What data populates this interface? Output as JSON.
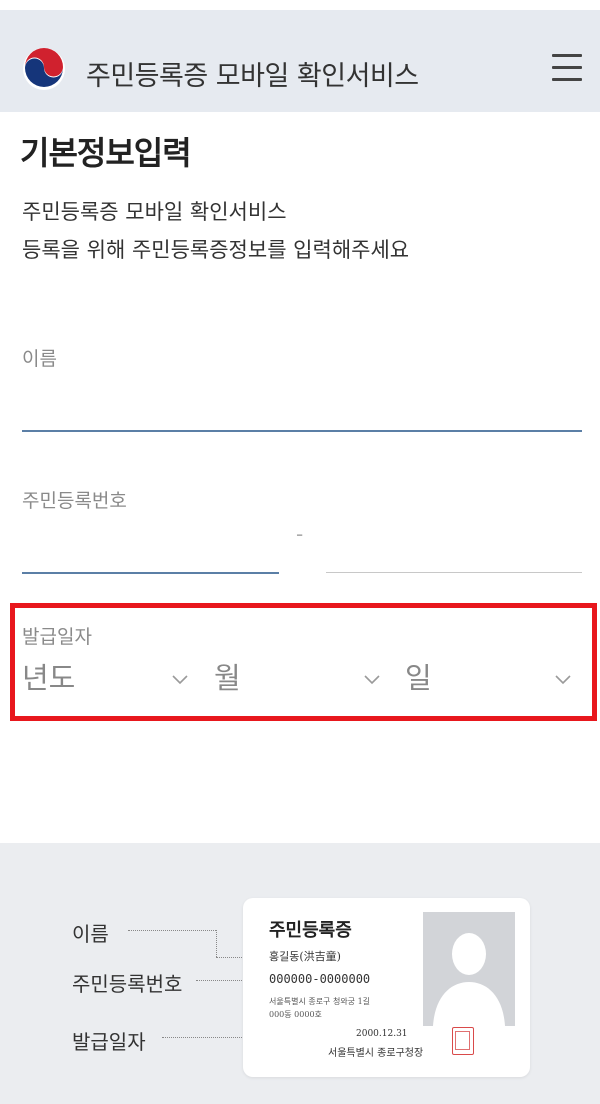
{
  "header": {
    "title": "주민등록증 모바일 확인서비스",
    "logo_icon": "taegeuk-logo-icon",
    "menu_icon": "hamburger-menu-icon"
  },
  "page": {
    "title": "기본정보입력",
    "intro_line1": "주민등록증 모바일 확인서비스",
    "intro_line2": "등록을 위해 주민등록증정보를 입력해주세요"
  },
  "form": {
    "name_label": "이름",
    "name_value": "",
    "rrn_label": "주민등록번호",
    "rrn_front_value": "",
    "rrn_back_value": "",
    "rrn_separator": "-",
    "issue_date_label": "발급일자",
    "year_select": "년도",
    "month_select": "월",
    "day_select": "일"
  },
  "guide": {
    "legend_name": "이름",
    "legend_rrn": "주민등록번호",
    "legend_issue_date": "발급일자",
    "card": {
      "title": "주민등록증",
      "holder_name": "홍길동(洪吉童)",
      "rrn": "000000-0000000",
      "address_line1": "서울특별시 종로구 청와궁 1길",
      "address_line2": "000동 0000호",
      "issue_date": "2000.12.31",
      "issuer": "서울특별시 종로구청장"
    }
  },
  "colors": {
    "header_bg": "#e6eaf0",
    "highlight_border": "#e8171d",
    "active_underline": "#5b7fa6",
    "guide_bg": "#ebedf0"
  }
}
